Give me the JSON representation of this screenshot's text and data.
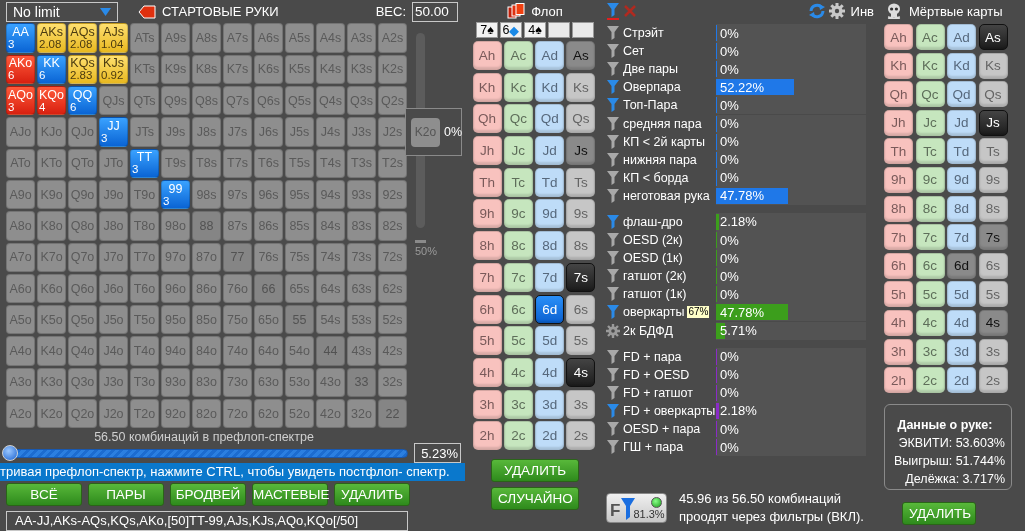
{
  "top_bar": {
    "game": "No limit",
    "title": "СТАРТОВЫЕ РУКИ",
    "weight_label": "ВЕС:",
    "weight_value": "50.00"
  },
  "hand_grid": [
    [
      {
        "label": "AA",
        "kind": "pair",
        "count": "3"
      },
      {
        "label": "AKs",
        "kind": "suited",
        "count": "2.08"
      },
      {
        "label": "AQs",
        "kind": "suited",
        "count": "2.08"
      },
      {
        "label": "AJs",
        "kind": "suited",
        "count": "1.04"
      },
      {
        "label": "ATs",
        "kind": "empty"
      },
      {
        "label": "A9s",
        "kind": "empty"
      },
      {
        "label": "A8s",
        "kind": "empty"
      },
      {
        "label": "A7s",
        "kind": "empty"
      },
      {
        "label": "A6s",
        "kind": "empty"
      },
      {
        "label": "A5s",
        "kind": "empty"
      },
      {
        "label": "A4s",
        "kind": "empty"
      },
      {
        "label": "A3s",
        "kind": "empty"
      },
      {
        "label": "A2s",
        "kind": "empty"
      }
    ],
    [
      {
        "label": "AKo",
        "kind": "offsuit",
        "count": "6"
      },
      {
        "label": "KK",
        "kind": "pair",
        "count": "6"
      },
      {
        "label": "KQs",
        "kind": "suited",
        "count": "2.83"
      },
      {
        "label": "KJs",
        "kind": "suited",
        "count": "0.92"
      },
      {
        "label": "KTs",
        "kind": "empty"
      },
      {
        "label": "K9s",
        "kind": "empty"
      },
      {
        "label": "K8s",
        "kind": "empty"
      },
      {
        "label": "K7s",
        "kind": "empty"
      },
      {
        "label": "K6s",
        "kind": "empty"
      },
      {
        "label": "K5s",
        "kind": "empty"
      },
      {
        "label": "K4s",
        "kind": "empty"
      },
      {
        "label": "K3s",
        "kind": "empty"
      },
      {
        "label": "K2s",
        "kind": "empty"
      }
    ],
    [
      {
        "label": "AQo",
        "kind": "offsuit",
        "count": "3"
      },
      {
        "label": "KQo",
        "kind": "offsuit",
        "count": "4"
      },
      {
        "label": "QQ",
        "kind": "pair",
        "count": "6"
      },
      {
        "label": "QJs",
        "kind": "empty"
      },
      {
        "label": "QTs",
        "kind": "empty"
      },
      {
        "label": "Q9s",
        "kind": "empty"
      },
      {
        "label": "Q8s",
        "kind": "empty"
      },
      {
        "label": "Q7s",
        "kind": "empty"
      },
      {
        "label": "Q6s",
        "kind": "empty"
      },
      {
        "label": "Q5s",
        "kind": "empty"
      },
      {
        "label": "Q4s",
        "kind": "empty"
      },
      {
        "label": "Q3s",
        "kind": "empty"
      },
      {
        "label": "Q2s",
        "kind": "empty"
      }
    ],
    [
      {
        "label": "AJo",
        "kind": "empty"
      },
      {
        "label": "KJo",
        "kind": "empty"
      },
      {
        "label": "QJo",
        "kind": "empty"
      },
      {
        "label": "JJ",
        "kind": "pair",
        "count": "3"
      },
      {
        "label": "JTs",
        "kind": "empty"
      },
      {
        "label": "J9s",
        "kind": "empty"
      },
      {
        "label": "J8s",
        "kind": "empty"
      },
      {
        "label": "J7s",
        "kind": "empty"
      },
      {
        "label": "J6s",
        "kind": "empty"
      },
      {
        "label": "J5s",
        "kind": "empty"
      },
      {
        "label": "J4s",
        "kind": "empty"
      },
      {
        "label": "J3s",
        "kind": "empty"
      },
      {
        "label": "J2s",
        "kind": "empty"
      }
    ],
    [
      {
        "label": "ATo",
        "kind": "empty"
      },
      {
        "label": "KTo",
        "kind": "empty"
      },
      {
        "label": "QTo",
        "kind": "empty"
      },
      {
        "label": "JTo",
        "kind": "empty"
      },
      {
        "label": "TT",
        "kind": "pair",
        "count": "3"
      },
      {
        "label": "T9s",
        "kind": "empty"
      },
      {
        "label": "T8s",
        "kind": "empty"
      },
      {
        "label": "T7s",
        "kind": "empty"
      },
      {
        "label": "T6s",
        "kind": "empty"
      },
      {
        "label": "T5s",
        "kind": "empty"
      },
      {
        "label": "T4s",
        "kind": "empty"
      },
      {
        "label": "T3s",
        "kind": "empty"
      },
      {
        "label": "T2s",
        "kind": "empty"
      }
    ],
    [
      {
        "label": "A9o",
        "kind": "empty"
      },
      {
        "label": "K9o",
        "kind": "empty"
      },
      {
        "label": "Q9o",
        "kind": "empty"
      },
      {
        "label": "J9o",
        "kind": "empty"
      },
      {
        "label": "T9o",
        "kind": "empty"
      },
      {
        "label": "99",
        "kind": "pair",
        "count": "3"
      },
      {
        "label": "98s",
        "kind": "empty"
      },
      {
        "label": "97s",
        "kind": "empty"
      },
      {
        "label": "96s",
        "kind": "empty"
      },
      {
        "label": "95s",
        "kind": "empty"
      },
      {
        "label": "94s",
        "kind": "empty"
      },
      {
        "label": "93s",
        "kind": "empty"
      },
      {
        "label": "92s",
        "kind": "empty"
      }
    ],
    [
      {
        "label": "A8o",
        "kind": "empty"
      },
      {
        "label": "K8o",
        "kind": "empty"
      },
      {
        "label": "Q8o",
        "kind": "empty"
      },
      {
        "label": "J8o",
        "kind": "empty"
      },
      {
        "label": "T8o",
        "kind": "empty"
      },
      {
        "label": "98o",
        "kind": "empty"
      },
      {
        "label": "88",
        "kind": "empty-pair"
      },
      {
        "label": "87s",
        "kind": "empty"
      },
      {
        "label": "86s",
        "kind": "empty"
      },
      {
        "label": "85s",
        "kind": "empty"
      },
      {
        "label": "84s",
        "kind": "empty"
      },
      {
        "label": "83s",
        "kind": "empty"
      },
      {
        "label": "82s",
        "kind": "empty"
      }
    ],
    [
      {
        "label": "A7o",
        "kind": "empty"
      },
      {
        "label": "K7o",
        "kind": "empty"
      },
      {
        "label": "Q7o",
        "kind": "empty"
      },
      {
        "label": "J7o",
        "kind": "empty"
      },
      {
        "label": "T7o",
        "kind": "empty"
      },
      {
        "label": "97o",
        "kind": "empty"
      },
      {
        "label": "87o",
        "kind": "empty"
      },
      {
        "label": "77",
        "kind": "empty-pair"
      },
      {
        "label": "76s",
        "kind": "empty"
      },
      {
        "label": "75s",
        "kind": "empty"
      },
      {
        "label": "74s",
        "kind": "empty"
      },
      {
        "label": "73s",
        "kind": "empty"
      },
      {
        "label": "72s",
        "kind": "empty"
      }
    ],
    [
      {
        "label": "A6o",
        "kind": "empty"
      },
      {
        "label": "K6o",
        "kind": "empty"
      },
      {
        "label": "Q6o",
        "kind": "empty"
      },
      {
        "label": "J6o",
        "kind": "empty"
      },
      {
        "label": "T6o",
        "kind": "empty"
      },
      {
        "label": "96o",
        "kind": "empty"
      },
      {
        "label": "86o",
        "kind": "empty"
      },
      {
        "label": "76o",
        "kind": "empty"
      },
      {
        "label": "66",
        "kind": "empty-pair"
      },
      {
        "label": "65s",
        "kind": "empty"
      },
      {
        "label": "64s",
        "kind": "empty"
      },
      {
        "label": "63s",
        "kind": "empty"
      },
      {
        "label": "62s",
        "kind": "empty"
      }
    ],
    [
      {
        "label": "A5o",
        "kind": "empty"
      },
      {
        "label": "K5o",
        "kind": "empty"
      },
      {
        "label": "Q5o",
        "kind": "empty"
      },
      {
        "label": "J5o",
        "kind": "empty"
      },
      {
        "label": "T5o",
        "kind": "empty"
      },
      {
        "label": "95o",
        "kind": "empty"
      },
      {
        "label": "85o",
        "kind": "empty"
      },
      {
        "label": "75o",
        "kind": "empty"
      },
      {
        "label": "65o",
        "kind": "empty"
      },
      {
        "label": "55",
        "kind": "empty-pair"
      },
      {
        "label": "54s",
        "kind": "empty"
      },
      {
        "label": "53s",
        "kind": "empty"
      },
      {
        "label": "52s",
        "kind": "empty"
      }
    ],
    [
      {
        "label": "A4o",
        "kind": "empty"
      },
      {
        "label": "K4o",
        "kind": "empty"
      },
      {
        "label": "Q4o",
        "kind": "empty"
      },
      {
        "label": "J4o",
        "kind": "empty"
      },
      {
        "label": "T4o",
        "kind": "empty"
      },
      {
        "label": "94o",
        "kind": "empty"
      },
      {
        "label": "84o",
        "kind": "empty"
      },
      {
        "label": "74o",
        "kind": "empty"
      },
      {
        "label": "64o",
        "kind": "empty"
      },
      {
        "label": "54o",
        "kind": "empty"
      },
      {
        "label": "44",
        "kind": "empty-pair"
      },
      {
        "label": "43s",
        "kind": "empty"
      },
      {
        "label": "42s",
        "kind": "empty"
      }
    ],
    [
      {
        "label": "A3o",
        "kind": "empty"
      },
      {
        "label": "K3o",
        "kind": "empty"
      },
      {
        "label": "Q3o",
        "kind": "empty"
      },
      {
        "label": "J3o",
        "kind": "empty"
      },
      {
        "label": "T3o",
        "kind": "empty"
      },
      {
        "label": "93o",
        "kind": "empty"
      },
      {
        "label": "83o",
        "kind": "empty"
      },
      {
        "label": "73o",
        "kind": "empty"
      },
      {
        "label": "63o",
        "kind": "empty"
      },
      {
        "label": "53o",
        "kind": "empty"
      },
      {
        "label": "43o",
        "kind": "empty"
      },
      {
        "label": "33",
        "kind": "empty-pair"
      },
      {
        "label": "32s",
        "kind": "empty"
      }
    ],
    [
      {
        "label": "A2o",
        "kind": "empty"
      },
      {
        "label": "K2o",
        "kind": "empty"
      },
      {
        "label": "Q2o",
        "kind": "empty"
      },
      {
        "label": "J2o",
        "kind": "empty"
      },
      {
        "label": "T2o",
        "kind": "empty"
      },
      {
        "label": "92o",
        "kind": "empty"
      },
      {
        "label": "82o",
        "kind": "empty"
      },
      {
        "label": "72o",
        "kind": "empty"
      },
      {
        "label": "62o",
        "kind": "empty"
      },
      {
        "label": "52o",
        "kind": "empty"
      },
      {
        "label": "42o",
        "kind": "empty"
      },
      {
        "label": "32o",
        "kind": "empty"
      },
      {
        "label": "22",
        "kind": "empty-pair"
      }
    ]
  ],
  "vertical_slider": {
    "label": "50%"
  },
  "tooltip": {
    "hand": "K2o",
    "value": "0%"
  },
  "range_slider": {
    "caption": "56.50 комбинаций в префлоп-спектре",
    "level": 0,
    "percent": "5.23%"
  },
  "hint": "тривая префлоп-спектр, нажмите CTRL, чтобы увидеть постфлоп- спектр.",
  "range_buttons": [
    "ВСЁ",
    "ПАРЫ",
    "БРОДВЕЙ",
    "МАСТЕВЫЕ",
    "УДАЛИТЬ"
  ],
  "range_text": "AA-JJ,AKs-AQs,KQs,AKo,[50]TT-99,AJs,KJs,AQo,KQo[/50]",
  "flop": {
    "title": "Флоп",
    "slots": [
      {
        "kind": "card",
        "rank": "7",
        "suit": "♠",
        "color": "#000000"
      },
      {
        "kind": "card",
        "rank": "6",
        "suit": "◆",
        "color": "#1a8ae8"
      },
      {
        "kind": "card",
        "rank": "4",
        "suit": "♠",
        "color": "#000000"
      },
      {
        "kind": "empty"
      },
      {
        "kind": "empty"
      }
    ],
    "columns": [
      {
        "kind": "hearts",
        "cards": [
          {
            "label": "Ah",
            "selected": false,
            "disabled": false
          },
          {
            "label": "Kh",
            "selected": false,
            "disabled": false
          },
          {
            "label": "Qh",
            "selected": false,
            "disabled": false
          },
          {
            "label": "Jh",
            "selected": false,
            "disabled": false
          },
          {
            "label": "Th",
            "selected": false,
            "disabled": false
          },
          {
            "label": "9h",
            "selected": false,
            "disabled": false
          },
          {
            "label": "8h",
            "selected": false,
            "disabled": false
          },
          {
            "label": "7h",
            "selected": false,
            "disabled": false
          },
          {
            "label": "6h",
            "selected": false,
            "disabled": false
          },
          {
            "label": "5h",
            "selected": false,
            "disabled": false
          },
          {
            "label": "4h",
            "selected": false,
            "disabled": false
          },
          {
            "label": "3h",
            "selected": false,
            "disabled": false
          },
          {
            "label": "2h",
            "selected": false,
            "disabled": false
          }
        ]
      },
      {
        "kind": "clubs",
        "cards": [
          {
            "label": "Ac",
            "selected": false,
            "disabled": false
          },
          {
            "label": "Kc",
            "selected": false,
            "disabled": false
          },
          {
            "label": "Qc",
            "selected": false,
            "disabled": false
          },
          {
            "label": "Jc",
            "selected": false,
            "disabled": false
          },
          {
            "label": "Tc",
            "selected": false,
            "disabled": false
          },
          {
            "label": "9c",
            "selected": false,
            "disabled": false
          },
          {
            "label": "8c",
            "selected": false,
            "disabled": false
          },
          {
            "label": "7c",
            "selected": false,
            "disabled": false
          },
          {
            "label": "6c",
            "selected": false,
            "disabled": false
          },
          {
            "label": "5c",
            "selected": false,
            "disabled": false
          },
          {
            "label": "4c",
            "selected": false,
            "disabled": false
          },
          {
            "label": "3c",
            "selected": false,
            "disabled": false
          },
          {
            "label": "2c",
            "selected": false,
            "disabled": false
          }
        ]
      },
      {
        "kind": "diamonds",
        "cards": [
          {
            "label": "Ad",
            "selected": false,
            "disabled": false
          },
          {
            "label": "Kd",
            "selected": false,
            "disabled": false
          },
          {
            "label": "Qd",
            "selected": false,
            "disabled": false
          },
          {
            "label": "Jd",
            "selected": false,
            "disabled": false
          },
          {
            "label": "Td",
            "selected": false,
            "disabled": false
          },
          {
            "label": "9d",
            "selected": false,
            "disabled": false
          },
          {
            "label": "8d",
            "selected": false,
            "disabled": false
          },
          {
            "label": "7d",
            "selected": false,
            "disabled": false
          },
          {
            "label": "6d",
            "selected": true,
            "disabled": false
          },
          {
            "label": "5d",
            "selected": false,
            "disabled": false
          },
          {
            "label": "4d",
            "selected": false,
            "disabled": false
          },
          {
            "label": "3d",
            "selected": false,
            "disabled": false
          },
          {
            "label": "2d",
            "selected": false,
            "disabled": false
          }
        ]
      },
      {
        "kind": "spades",
        "cards": [
          {
            "label": "As",
            "selected": false,
            "disabled": true
          },
          {
            "label": "Ks",
            "selected": false,
            "disabled": false
          },
          {
            "label": "Qs",
            "selected": false,
            "disabled": false
          },
          {
            "label": "Js",
            "selected": false,
            "disabled": true
          },
          {
            "label": "Ts",
            "selected": false,
            "disabled": false
          },
          {
            "label": "9s",
            "selected": false,
            "disabled": false
          },
          {
            "label": "8s",
            "selected": false,
            "disabled": false
          },
          {
            "label": "7s",
            "selected": true,
            "disabled": false
          },
          {
            "label": "6s",
            "selected": false,
            "disabled": false
          },
          {
            "label": "5s",
            "selected": false,
            "disabled": false
          },
          {
            "label": "4s",
            "selected": true,
            "disabled": false
          },
          {
            "label": "3s",
            "selected": false,
            "disabled": false
          },
          {
            "label": "2s",
            "selected": false,
            "disabled": false
          }
        ]
      }
    ],
    "buttons": [
      "УДАЛИТЬ",
      "СЛУЧАЙНО"
    ]
  },
  "filters": {
    "inv_label": "Инв",
    "groups": [
      {
        "color": "#1f78e8",
        "rows": [
          {
            "label": "Стрэйт",
            "value": "0%",
            "level": 0,
            "active": false,
            "kind": "filter"
          },
          {
            "label": "Сет",
            "value": "0%",
            "level": 0,
            "active": false,
            "kind": "filter"
          },
          {
            "label": "Две пары",
            "value": "0%",
            "level": 0,
            "active": false,
            "kind": "filter"
          },
          {
            "label": "Оверпара",
            "value": "52.22%",
            "level": 0.5222,
            "active": true,
            "kind": "filter"
          },
          {
            "label": "Топ-Пара",
            "value": "0%",
            "level": 0,
            "active": true,
            "kind": "filter"
          },
          {
            "label": "средняя пара",
            "value": "0%",
            "level": 0,
            "active": false,
            "kind": "filter"
          },
          {
            "label": "КП < 2й карты",
            "value": "0%",
            "level": 0,
            "active": false,
            "kind": "filter"
          },
          {
            "label": "нижняя пара",
            "value": "0%",
            "level": 0,
            "active": false,
            "kind": "filter"
          },
          {
            "label": "КП < борда",
            "value": "0%",
            "level": 0,
            "active": false,
            "kind": "filter"
          },
          {
            "label": "неготовая рука",
            "value": "47.78%",
            "level": 0.4778,
            "active": false,
            "kind": "filter"
          }
        ]
      },
      {
        "color": "#3c9e1c",
        "rows": [
          {
            "label": "флаш-дро",
            "value": "2.18%",
            "level": 0.0218,
            "active": true,
            "kind": "filter"
          },
          {
            "label": "OESD (2к)",
            "value": "0%",
            "level": 0,
            "active": false,
            "kind": "filter"
          },
          {
            "label": "OESD (1к)",
            "value": "0%",
            "level": 0,
            "active": false,
            "kind": "filter"
          },
          {
            "label": "гатшот (2к)",
            "value": "0%",
            "level": 0,
            "active": false,
            "kind": "filter"
          },
          {
            "label": "гатшот (1к)",
            "value": "0%",
            "level": 0,
            "active": false,
            "kind": "filter"
          },
          {
            "label": "оверкарты",
            "value": "47.78%",
            "level": 0.4778,
            "active": true,
            "kind": "filter",
            "badge": "67%"
          },
          {
            "label": "2к БДФД",
            "value": "5.71%",
            "level": 0.0571,
            "active": false,
            "kind": "gear"
          }
        ]
      },
      {
        "color": "#8a2bc8",
        "rows": [
          {
            "label": "FD + пара",
            "value": "0%",
            "level": 0,
            "active": false,
            "kind": "filter"
          },
          {
            "label": "FD + OESD",
            "value": "0%",
            "level": 0,
            "active": false,
            "kind": "filter"
          },
          {
            "label": "FD + гатшот",
            "value": "0%",
            "level": 0,
            "active": false,
            "kind": "filter"
          },
          {
            "label": "FD + оверкарты",
            "value": "2.18%",
            "level": 0.0218,
            "active": true,
            "kind": "filter"
          },
          {
            "label": "OESD + пара",
            "value": "0%",
            "level": 0,
            "active": false,
            "kind": "filter"
          },
          {
            "label": "ГШ + пара",
            "value": "0%",
            "level": 0,
            "active": false,
            "kind": "filter"
          }
        ]
      }
    ],
    "summary": {
      "letter": "F",
      "percent": "81.3%",
      "on": true,
      "text": "45.96 из 56.50 комбинаций проодят через фильтры (ВКЛ)."
    }
  },
  "dead_cards": {
    "title": "Мёртвые карты",
    "columns": [
      {
        "kind": "hearts",
        "cards": [
          {
            "label": "Ah",
            "selected": false,
            "disabled": false
          },
          {
            "label": "Kh",
            "selected": false,
            "disabled": false
          },
          {
            "label": "Qh",
            "selected": false,
            "disabled": false
          },
          {
            "label": "Jh",
            "selected": false,
            "disabled": false
          },
          {
            "label": "Th",
            "selected": false,
            "disabled": false
          },
          {
            "label": "9h",
            "selected": false,
            "disabled": false
          },
          {
            "label": "8h",
            "selected": false,
            "disabled": false
          },
          {
            "label": "7h",
            "selected": false,
            "disabled": false
          },
          {
            "label": "6h",
            "selected": false,
            "disabled": false
          },
          {
            "label": "5h",
            "selected": false,
            "disabled": false
          },
          {
            "label": "4h",
            "selected": false,
            "disabled": false
          },
          {
            "label": "3h",
            "selected": false,
            "disabled": false
          },
          {
            "label": "2h",
            "selected": false,
            "disabled": false
          }
        ]
      },
      {
        "kind": "clubs",
        "cards": [
          {
            "label": "Ac",
            "selected": false,
            "disabled": false
          },
          {
            "label": "Kc",
            "selected": false,
            "disabled": false
          },
          {
            "label": "Qc",
            "selected": false,
            "disabled": false
          },
          {
            "label": "Jc",
            "selected": false,
            "disabled": false
          },
          {
            "label": "Tc",
            "selected": false,
            "disabled": false
          },
          {
            "label": "9c",
            "selected": false,
            "disabled": false
          },
          {
            "label": "8c",
            "selected": false,
            "disabled": false
          },
          {
            "label": "7c",
            "selected": false,
            "disabled": false
          },
          {
            "label": "6c",
            "selected": false,
            "disabled": false
          },
          {
            "label": "5c",
            "selected": false,
            "disabled": false
          },
          {
            "label": "4c",
            "selected": false,
            "disabled": false
          },
          {
            "label": "3c",
            "selected": false,
            "disabled": false
          },
          {
            "label": "2c",
            "selected": false,
            "disabled": false
          }
        ]
      },
      {
        "kind": "diamonds",
        "cards": [
          {
            "label": "Ad",
            "selected": false,
            "disabled": false
          },
          {
            "label": "Kd",
            "selected": false,
            "disabled": false
          },
          {
            "label": "Qd",
            "selected": false,
            "disabled": false
          },
          {
            "label": "Jd",
            "selected": false,
            "disabled": false
          },
          {
            "label": "Td",
            "selected": false,
            "disabled": false
          },
          {
            "label": "9d",
            "selected": false,
            "disabled": false
          },
          {
            "label": "8d",
            "selected": false,
            "disabled": false
          },
          {
            "label": "7d",
            "selected": false,
            "disabled": false
          },
          {
            "label": "6d",
            "selected": false,
            "disabled": true
          },
          {
            "label": "5d",
            "selected": false,
            "disabled": false
          },
          {
            "label": "4d",
            "selected": false,
            "disabled": false
          },
          {
            "label": "3d",
            "selected": false,
            "disabled": false
          },
          {
            "label": "2d",
            "selected": false,
            "disabled": false
          }
        ]
      },
      {
        "kind": "spades",
        "cards": [
          {
            "label": "As",
            "selected": true,
            "disabled": false
          },
          {
            "label": "Ks",
            "selected": false,
            "disabled": false
          },
          {
            "label": "Qs",
            "selected": false,
            "disabled": false
          },
          {
            "label": "Js",
            "selected": true,
            "disabled": false
          },
          {
            "label": "Ts",
            "selected": false,
            "disabled": false
          },
          {
            "label": "9s",
            "selected": false,
            "disabled": false
          },
          {
            "label": "8s",
            "selected": false,
            "disabled": false
          },
          {
            "label": "7s",
            "selected": false,
            "disabled": true
          },
          {
            "label": "6s",
            "selected": false,
            "disabled": false
          },
          {
            "label": "5s",
            "selected": false,
            "disabled": false
          },
          {
            "label": "4s",
            "selected": false,
            "disabled": true
          },
          {
            "label": "3s",
            "selected": false,
            "disabled": false
          },
          {
            "label": "2s",
            "selected": false,
            "disabled": false
          }
        ]
      }
    ],
    "hand_info": {
      "title": "Данные о руке:",
      "lines": [
        "ЭКВИТИ: 53.603%",
        "Выигрыш: 51.744%",
        "Делёжка: 3.717%"
      ]
    },
    "button": "УДАЛИТЬ"
  }
}
